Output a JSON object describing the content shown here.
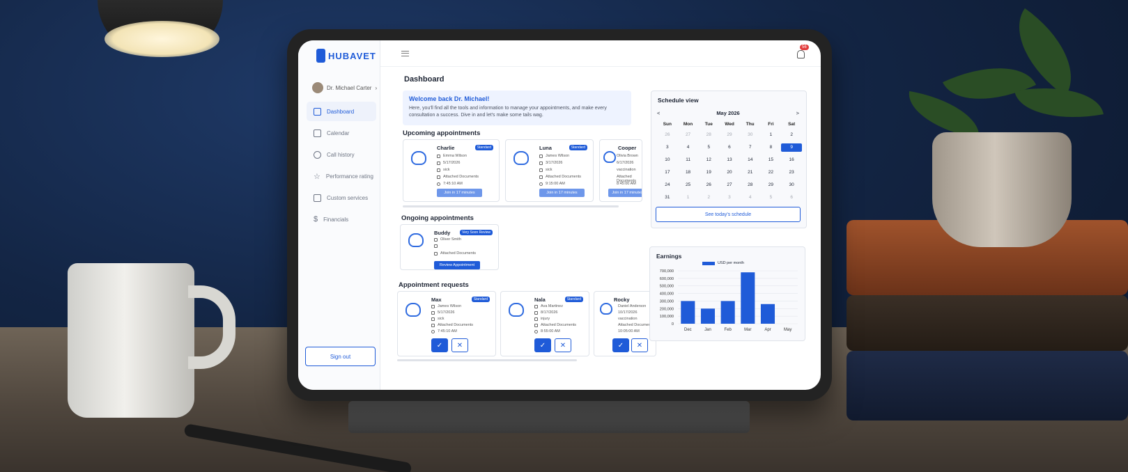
{
  "app": {
    "brand": "HUBAVET",
    "page_title": "Dashboard"
  },
  "colors": {
    "accent": "#1f5bd8",
    "join_button": "#6e97ea",
    "notification_badge": "#e23b3b"
  },
  "header": {
    "notification_count": "56"
  },
  "sidebar": {
    "user_name": "Dr. Michael Carter",
    "items": [
      {
        "label": "Dashboard",
        "icon": "home-icon"
      },
      {
        "label": "Calendar",
        "icon": "calendar-icon"
      },
      {
        "label": "Call history",
        "icon": "phone-icon"
      },
      {
        "label": "Performance rating",
        "icon": "star-icon"
      },
      {
        "label": "Custom services",
        "icon": "clipboard-icon"
      },
      {
        "label": "Financials",
        "icon": "dollar-icon"
      }
    ],
    "sign_out": "Sign out"
  },
  "welcome": {
    "title": "Welcome back Dr. Michael!",
    "text": "Here, you'll find all the tools and information to manage your appointments, and make every consultation a success. Dive in and let's make some tails wag."
  },
  "upcoming": {
    "title": "Upcoming appointments",
    "cards": [
      {
        "name": "Charlie",
        "tag": "Standard",
        "owner": "Emma Wilson",
        "date": "5/17/2026",
        "reason": "sick",
        "docs": "Attached Documents",
        "time": "7:45:10 AM",
        "button": "Join in 17 minutes"
      },
      {
        "name": "Luna",
        "tag": "Standard",
        "owner": "James Wilson",
        "date": "3/17/2026",
        "reason": "sick",
        "docs": "Attached Documents",
        "time": "9:15:00 AM",
        "button": "Join in 17 minutes"
      },
      {
        "name": "Cooper",
        "tag": "",
        "owner": "Olivia Brown",
        "date": "6/17/2026",
        "reason": "vaccination",
        "docs": "Attached Documents",
        "time": "8:45:00 AM",
        "button": "Join in 17 minutes"
      }
    ]
  },
  "ongoing": {
    "title": "Ongoing appointments",
    "cards": [
      {
        "name": "Buddy",
        "tag": "Very Soon Review",
        "owner": "Oliver Smith",
        "date": "",
        "docs": "Attached Documents",
        "button": "Review Appointment"
      }
    ]
  },
  "requests": {
    "title": "Appointment requests",
    "cards": [
      {
        "name": "Max",
        "tag": "Standard",
        "owner": "James Wilson",
        "date": "5/17/2026",
        "reason": "sick",
        "docs": "Attached Documents",
        "time": "7:45:10 AM",
        "accept": "✓",
        "decline": "✕"
      },
      {
        "name": "Nala",
        "tag": "Standard",
        "owner": "Ava Martinez",
        "date": "8/17/2026",
        "reason": "injury",
        "docs": "Attached Documents",
        "time": "8:55:00 AM",
        "accept": "✓",
        "decline": "✕"
      },
      {
        "name": "Rocky",
        "tag": "",
        "owner": "Daniel Anderson",
        "date": "10/17/2026",
        "reason": "vaccination",
        "docs": "Attached Documents",
        "time": "10:05:00 AM",
        "accept": "✓",
        "decline": "✕"
      }
    ]
  },
  "schedule": {
    "title": "Schedule view",
    "prev": "<",
    "next": ">",
    "month": "May 2026",
    "weekdays": [
      "Sun",
      "Mon",
      "Tue",
      "Wed",
      "Thu",
      "Fri",
      "Sat"
    ],
    "days": [
      {
        "d": "26",
        "muted": true
      },
      {
        "d": "27",
        "muted": true
      },
      {
        "d": "28",
        "muted": true
      },
      {
        "d": "29",
        "muted": true
      },
      {
        "d": "30",
        "muted": true
      },
      {
        "d": "1"
      },
      {
        "d": "2"
      },
      {
        "d": "3"
      },
      {
        "d": "4"
      },
      {
        "d": "5"
      },
      {
        "d": "6"
      },
      {
        "d": "7"
      },
      {
        "d": "8"
      },
      {
        "d": "9",
        "selected": true
      },
      {
        "d": "10"
      },
      {
        "d": "11"
      },
      {
        "d": "12"
      },
      {
        "d": "13"
      },
      {
        "d": "14"
      },
      {
        "d": "15"
      },
      {
        "d": "16"
      },
      {
        "d": "17"
      },
      {
        "d": "18"
      },
      {
        "d": "19"
      },
      {
        "d": "20"
      },
      {
        "d": "21"
      },
      {
        "d": "22"
      },
      {
        "d": "23"
      },
      {
        "d": "24"
      },
      {
        "d": "25"
      },
      {
        "d": "26"
      },
      {
        "d": "27"
      },
      {
        "d": "28"
      },
      {
        "d": "29"
      },
      {
        "d": "30"
      },
      {
        "d": "31"
      },
      {
        "d": "1",
        "muted": true
      },
      {
        "d": "2",
        "muted": true
      },
      {
        "d": "3",
        "muted": true
      },
      {
        "d": "4",
        "muted": true
      },
      {
        "d": "5",
        "muted": true
      },
      {
        "d": "6",
        "muted": true
      }
    ],
    "button": "See today's schedule"
  },
  "earnings": {
    "title": "Earnings"
  },
  "chart_data": {
    "type": "bar",
    "categories": [
      "Dec",
      "Jan",
      "Feb",
      "Mar",
      "Apr",
      "May"
    ],
    "series": [
      {
        "name": "USD per month",
        "values": [
          300000,
          200000,
          300000,
          680000,
          260000,
          0
        ]
      }
    ],
    "ylim": [
      0,
      700000
    ],
    "yticks": [
      "0",
      "100,000",
      "200,000",
      "300,000",
      "400,000",
      "500,000",
      "600,000",
      "700,000"
    ],
    "legend": "top",
    "grid": true
  }
}
